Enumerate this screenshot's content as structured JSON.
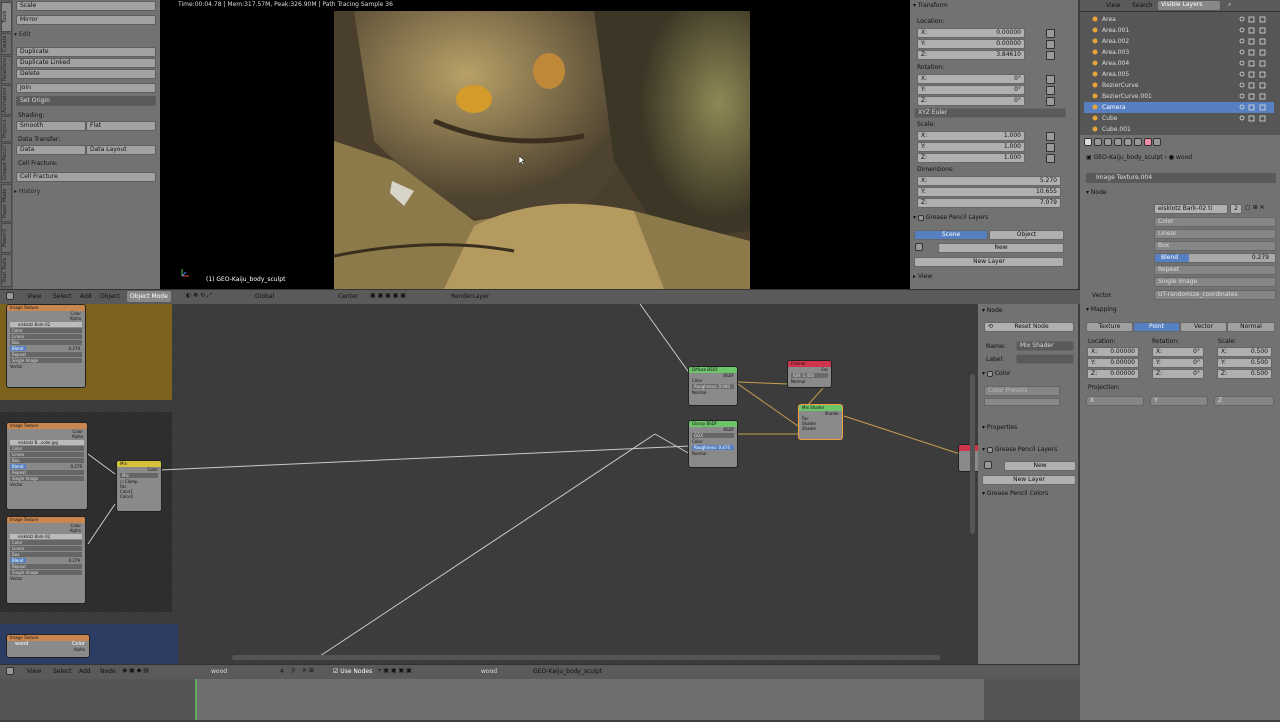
{
  "viewport_header": {
    "stats": "Time:00:04.78 | Mem:317.57M, Peak:326.90M | Path Tracing Sample 36",
    "object_label": "(1) GEO-Kaiju_body_sculpt"
  },
  "tool_tabs": [
    "Tools",
    "Create",
    "Relations",
    "Animation",
    "Physics",
    "Grease Pencil",
    "Paper Mode",
    "PowerS",
    "Shot Tools"
  ],
  "toolshelf": {
    "scale": "Scale",
    "mirror": "Mirror",
    "edit_header": "Edit",
    "duplicate": "Duplicate",
    "duplicate_linked": "Duplicate Linked",
    "delete": "Delete",
    "join": "Join",
    "set_origin": "Set Origin",
    "shading_label": "Shading:",
    "smooth": "Smooth",
    "flat": "Flat",
    "data_transfer_label": "Data Transfer:",
    "data": "Data",
    "data_layout": "Data Layout",
    "cell_fracture_label": "Cell Fracture:",
    "cell_fracture": "Cell Fracture",
    "history": "History"
  },
  "transform_panel": {
    "header": "Transform",
    "location_label": "Location:",
    "location": {
      "x": "0.00000",
      "y": "0.00000",
      "z": "3.84610"
    },
    "rotation_label": "Rotation:",
    "rotation": {
      "x": "0°",
      "y": "0°",
      "z": "0°"
    },
    "rotation_mode": "XYZ Euler",
    "scale_label": "Scale:",
    "scale": {
      "x": "1.000",
      "y": "1.000",
      "z": "1.000"
    },
    "dimensions_label": "Dimensions:",
    "dimensions": {
      "x": "5.270",
      "y": "10.655",
      "z": "7.079"
    },
    "grease_header": "Grease Pencil Layers",
    "scene_tab": "Scene",
    "object_tab": "Object",
    "new": "New",
    "new_layer": "New Layer",
    "view_header": "View",
    "axis_x": "X:",
    "axis_y": "Y:",
    "axis_z": "Z:"
  },
  "outliner": {
    "view": "View",
    "search": "Search",
    "filter": "Visible Layers",
    "items": [
      "Area",
      "Area.001",
      "Area.002",
      "Area.003",
      "Area.004",
      "Area.005",
      "BezierCurve",
      "BezierCurve.001",
      "Camera",
      "Cube",
      "Cube.001"
    ],
    "selected": "Camera"
  },
  "properties": {
    "object": "GEO-Kaiju_body_sculpt",
    "material": "wood",
    "texture_node": "Image Texture.004",
    "node_header": "Node",
    "image_name": "eisklotz Bark-02 ti",
    "users": "2",
    "color": "Color",
    "interpolation": "Linear",
    "projection": "Box",
    "blend_label": "Blend",
    "blend_value": "0.279",
    "extension": "Repeat",
    "source": "Single Image",
    "vector_label": "Vector:",
    "vector_value": "UT-randomize_coordinates",
    "mapping_header": "Mapping",
    "mapping_tabs": [
      "Texture",
      "Point",
      "Vector",
      "Normal"
    ],
    "location_label": "Location:",
    "rotation_label": "Rotation:",
    "scale_label": "Scale:",
    "location": [
      "0.00000",
      "0.00000",
      "0.00000"
    ],
    "rotation": [
      "0°",
      "0°",
      "0°"
    ],
    "scale": [
      "0.500",
      "0.500",
      "0.500"
    ],
    "projection_label": "Projection:",
    "proj": [
      "X",
      "Y",
      "Z"
    ],
    "axes": [
      "X:",
      "Y:",
      "Z:"
    ]
  },
  "viewport_menu": {
    "view": "View",
    "select": "Select",
    "add": "Add",
    "object": "Object",
    "mode": "Object Mode",
    "orientation": "Global",
    "pivot": "Center",
    "layer": "RenderLayer"
  },
  "node_region": {
    "node_header": "Node",
    "reset": "Reset Node",
    "name_label": "Name:",
    "name_value": "Mix Shader",
    "label_label": "Label:",
    "color_header": "Color",
    "color_presets": "Color Presets",
    "properties_header": "Properties",
    "grease_header": "Grease Pencil Layers",
    "new": "New",
    "new_layer": "New Layer",
    "grease_colors": "Grease Pencil Colors"
  },
  "node_editor_menu": {
    "view": "View",
    "select": "Select",
    "add": "Add",
    "node": "Node",
    "material": "wood",
    "users": "4",
    "fake": "F",
    "use_nodes": "Use Nodes",
    "material2": "wood",
    "object": "GEO-Kaiju_body_sculpt"
  },
  "nodes": {
    "diffuse": {
      "title": "Diffuse BSDF",
      "bsdf": "BSDF",
      "color": "Color",
      "roughness": "Roughness: 0.000",
      "normal": "Normal"
    },
    "glossy": {
      "title": "Glossy BSDF",
      "bsdf": "BSDF",
      "ggx": "GGX",
      "color": "Color",
      "roughness": "Roughness: 0.474",
      "normal": "Normal"
    },
    "fresnel": {
      "title": "Fresnel",
      "fac": "Fac",
      "ior": "IOR:",
      "ior_value": "1.450",
      "normal": "Normal"
    },
    "mix": {
      "title": "Mix Shader",
      "shader": "Shader",
      "fac": "Fac",
      "shader1": "Shader",
      "shader2": "Shader"
    },
    "mixrgb": {
      "title": "Mix",
      "color": "Color",
      "mix": "Mix",
      "clamp": "Clamp",
      "fac": "Fac",
      "color1": "Color1",
      "color2": "Color2"
    },
    "tex1": {
      "title": "Image Texture",
      "color": "Color",
      "alpha": "Alpha",
      "image": "eisklotz Bark-02",
      "blend": "Blend",
      "blend_value": "0.279"
    },
    "tex2": {
      "title": "Image Texture",
      "color": "Color",
      "alpha": "Alpha",
      "image": "eisklotz B...color.jpg",
      "blend": "Blend",
      "blend_value": "0.279"
    },
    "tex3": {
      "title": "Image Texture",
      "color": "Color",
      "alpha": "Alpha",
      "image": "eisklotz Bark-02",
      "blend": "Blend",
      "blend_value": "0.279"
    },
    "tex4": {
      "title": "Image Texture",
      "label": "wood",
      "color": "Color",
      "alpha": "Alpha"
    },
    "rows": [
      "Color",
      "Linear",
      "Box",
      "Blend",
      "Repeat",
      "Single Image",
      "Vector"
    ]
  }
}
